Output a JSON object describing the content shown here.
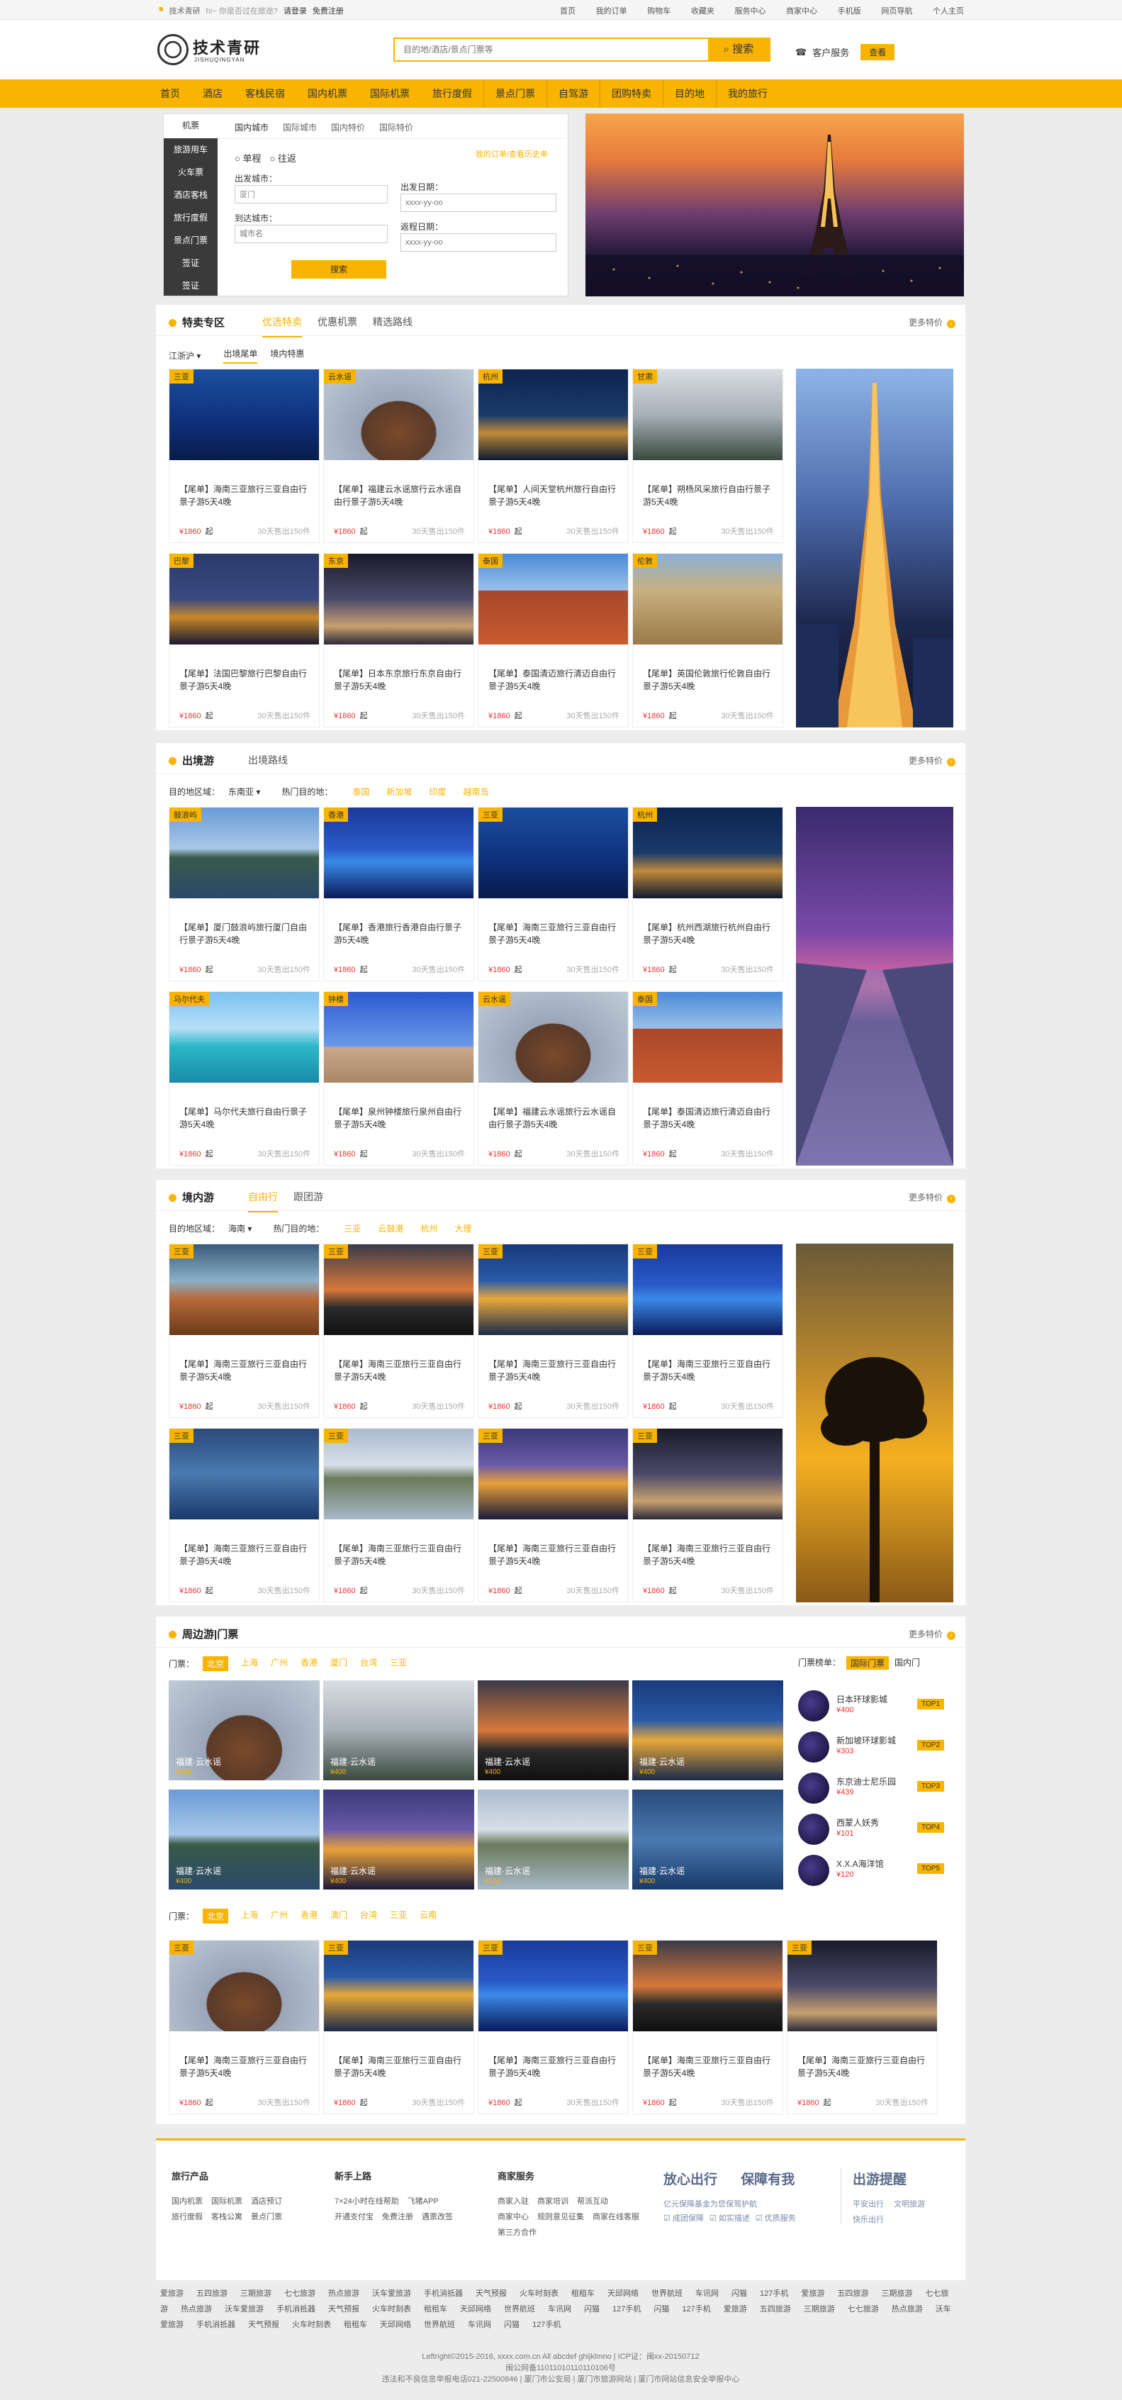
{
  "topbar": {
    "welcome": "技术青研",
    "greeting": "hi~ 你是否过在旅途?",
    "login": "请登录",
    "register": "免费注册",
    "links": [
      "首页",
      "我的订单",
      "购物车",
      "收藏夹",
      "服务中心",
      "商家中心",
      "手机版",
      "网页导航",
      "个人主页"
    ]
  },
  "header": {
    "logo_cn": "技术青研",
    "logo_en": "JISHUQINGYAN",
    "search_placeholder": "目的地/酒店/景点门票等",
    "search_button": "搜索",
    "service": "客户服务",
    "service_btn": "查看"
  },
  "nav": [
    "首页",
    "酒店",
    "客栈民宿",
    "国内机票",
    "国际机票",
    "旅行度假",
    "景点门票",
    "自驾游",
    "团购特卖",
    "目的地",
    "我的旅行"
  ],
  "booking": {
    "side": [
      "机票",
      "旅游用车",
      "火车票",
      "酒店客栈",
      "旅行度假",
      "景点门票",
      "签证",
      "签证"
    ],
    "tabs": [
      "国内城市",
      "国际城市",
      "国内特价",
      "国际特价"
    ],
    "trip_one": "单程",
    "trip_round": "往返",
    "my_orders": "我的订单/查看历史单",
    "from_label": "出发城市：",
    "from_value": "厦门",
    "to_label": "到达城市：",
    "to_placeholder": "城市名",
    "dep_label": "出发日期：",
    "dep_placeholder": "xxxx-yy-oo",
    "ret_label": "返程日期：",
    "ret_placeholder": "xxxx-yy-oo",
    "submit": "搜索"
  },
  "s1": {
    "title": "特卖专区",
    "tabs": [
      "优选特卖",
      "优惠机票",
      "精选路线"
    ],
    "more": "更多特价",
    "filter_city": "江浙沪",
    "filter_tabs": [
      "出境尾单",
      "境内特惠"
    ],
    "cards": [
      {
        "tag": "三亚",
        "title": "【尾单】海南三亚旅行三亚自由行景子游5天4晚",
        "img": "diver"
      },
      {
        "tag": "云水谣",
        "title": "【尾单】福建云水谣旅行云水谣自由行景子游5天4晚",
        "img": "tulou"
      },
      {
        "tag": "杭州",
        "title": "【尾单】人间天堂杭州旅行自由行景子游5天4晚",
        "img": "pagoda"
      },
      {
        "tag": "甘肃",
        "title": "【尾单】朔杨风采旅行自由行景子游5天4晚",
        "img": "mist"
      },
      {
        "tag": "巴黎",
        "title": "【尾单】法国巴黎旅行巴黎自由行景子游5天4晚",
        "img": "paris"
      },
      {
        "tag": "东京",
        "title": "【尾单】日本东京旅行东京自由行景子游5天4晚",
        "img": "tokyo"
      },
      {
        "tag": "泰国",
        "title": "【尾单】泰国清迈旅行清迈自由行景子游5天4晚",
        "img": "thai"
      },
      {
        "tag": "伦敦",
        "title": "【尾单】英国伦敦旅行伦敦自由行景子游5天4晚",
        "img": "london"
      }
    ]
  },
  "s2": {
    "title": "出境游",
    "tabs": [
      "出境路线"
    ],
    "more": "更多特价",
    "area_label": "目的地区域：",
    "area_value": "东南亚",
    "hot_label": "热门目的地：",
    "hot": [
      "泰国",
      "新加坡",
      "印度",
      "越南岛"
    ],
    "cards": [
      {
        "tag": "鼓浪屿",
        "title": "【尾单】厦门鼓浪屿旅行厦门自由行景子游5天4晚",
        "img": "gulang"
      },
      {
        "tag": "香港",
        "title": "【尾单】香港旅行香港自由行景子游5天4晚",
        "img": "hk"
      },
      {
        "tag": "三亚",
        "title": "【尾单】海南三亚旅行三亚自由行景子游5天4晚",
        "img": "diver"
      },
      {
        "tag": "杭州",
        "title": "【尾单】杭州西湖旅行杭州自由行景子游5天4晚",
        "img": "pagoda"
      },
      {
        "tag": "马尔代夫",
        "title": "【尾单】马尔代夫旅行自由行景子游5天4晚",
        "img": "maldives"
      },
      {
        "tag": "钟楼",
        "title": "【尾单】泉州钟楼旅行泉州自由行景子游5天4晚",
        "img": "clock"
      },
      {
        "tag": "云水谣",
        "title": "【尾单】福建云水谣旅行云水谣自由行景子游5天4晚",
        "img": "tulou"
      },
      {
        "tag": "泰国",
        "title": "【尾单】泰国清迈旅行清迈自由行景子游5天4晚",
        "img": "thai"
      }
    ]
  },
  "s3": {
    "title": "境内游",
    "tabs": [
      "自由行",
      "跟团游"
    ],
    "more": "更多特价",
    "area_label": "目的地区域：",
    "area_value": "海南",
    "hot_label": "热门目的地：",
    "hot": [
      "三亚",
      "云鼓港",
      "杭州",
      "大理"
    ],
    "cards": [
      {
        "tag": "三亚",
        "title": "【尾单】海南三亚旅行三亚自由行景子游5天4晚",
        "img": "resort"
      },
      {
        "tag": "三亚",
        "title": "【尾单】海南三亚旅行三亚自由行景子游5天4晚",
        "img": "sunset"
      },
      {
        "tag": "三亚",
        "title": "【尾单】海南三亚旅行三亚自由行景子游5天4晚",
        "img": "palace"
      },
      {
        "tag": "三亚",
        "title": "【尾单】海南三亚旅行三亚自由行景子游5天4晚",
        "img": "hk"
      },
      {
        "tag": "三亚",
        "title": "【尾单】海南三亚旅行三亚自由行景子游5天4晚",
        "img": "blue"
      },
      {
        "tag": "三亚",
        "title": "【尾单】海南三亚旅行三亚自由行景子游5天4晚",
        "img": "lake"
      },
      {
        "tag": "三亚",
        "title": "【尾单】海南三亚旅行三亚自由行景子游5天4晚",
        "img": "paris2"
      },
      {
        "tag": "三亚",
        "title": "【尾单】海南三亚旅行三亚自由行景子游5天4晚",
        "img": "tokyo"
      }
    ]
  },
  "card_price": "¥1860",
  "card_price_unit": "起",
  "card_sold": "30天售出150件",
  "s4": {
    "title": "周边游|门票",
    "more": "更多特价",
    "ticket_label": "门票：",
    "cities": [
      "北京",
      "上海",
      "广州",
      "香港",
      "厦门",
      "台湾",
      "三亚"
    ],
    "rank_label": "门票榜单：",
    "rank_tabs": [
      "国际门票",
      "国内门"
    ],
    "minis": [
      {
        "cap": "福建·云水谣",
        "img": "tulou"
      },
      {
        "cap": "福建·云水谣",
        "img": "mist"
      },
      {
        "cap": "福建·云水谣",
        "img": "sunset"
      },
      {
        "cap": "福建·云水谣",
        "img": "palace"
      },
      {
        "cap": "福建·云水谣",
        "img": "gulang"
      },
      {
        "cap": "福建·云水谣",
        "img": "paris2"
      },
      {
        "cap": "福建·云水谣",
        "img": "lake"
      },
      {
        "cap": "福建·云水谣",
        "img": "blue"
      }
    ],
    "mini_price": "¥400",
    "ranks": [
      {
        "name": "日本环球影城",
        "price": "¥400",
        "top": "TOP1"
      },
      {
        "name": "新加坡环球影城",
        "price": "¥303",
        "top": "TOP2"
      },
      {
        "name": "东京迪士尼乐园",
        "price": "¥439",
        "top": "TOP3"
      },
      {
        "name": "西蒙人妖秀",
        "price": "¥101",
        "top": "TOP4"
      },
      {
        "name": "X.X.A海洋馆",
        "price": "¥120",
        "top": "TOP5"
      }
    ],
    "cities2": [
      "北京",
      "上海",
      "广州",
      "香港",
      "澳门",
      "台湾",
      "三亚",
      "云南"
    ],
    "cards": [
      {
        "tag": "三亚",
        "title": "【尾单】海南三亚旅行三亚自由行景子游5天4晚",
        "img": "tulou"
      },
      {
        "tag": "三亚",
        "title": "【尾单】海南三亚旅行三亚自由行景子游5天4晚",
        "img": "palace"
      },
      {
        "tag": "三亚",
        "title": "【尾单】海南三亚旅行三亚自由行景子游5天4晚",
        "img": "hk"
      },
      {
        "tag": "三亚",
        "title": "【尾单】海南三亚旅行三亚自由行景子游5天4晚",
        "img": "sunset"
      },
      {
        "tag": "三亚",
        "title": "【尾单】海南三亚旅行三亚自由行景子游5天4晚",
        "img": "tokyo"
      }
    ]
  },
  "footer": {
    "cols": [
      {
        "h": "旅行产品",
        "items": [
          "国内机票",
          "国际机票",
          "酒店预订",
          "旅行度假",
          "客栈公寓",
          "景点门票"
        ]
      },
      {
        "h": "新手上路",
        "items": [
          "7×24小时在线帮助",
          "飞猪APP",
          "开通支付宝",
          "免费注册",
          "遇票改签"
        ]
      },
      {
        "h": "商家服务",
        "items": [
          "商家入驻",
          "商家培训",
          "帮派互动",
          "商家中心",
          "规则意见征集",
          "商家在线客服",
          "第三方合作"
        ]
      }
    ],
    "slogan1": "放心出行",
    "slogan2": "保障有我",
    "slogan_sub": "亿元保障基金为您保驾护航",
    "slogan_checks": [
      "成团保障",
      "如实描述",
      "优质服务"
    ],
    "tips_h": "出游提醒",
    "tips": [
      "平安出行",
      "文明旅游",
      "快乐出行"
    ],
    "links": [
      "爱旅游",
      "五四旅游",
      "三期旅游",
      "七七旅游",
      "热点旅游",
      "沃车爱旅游",
      "手机消抵器",
      "天气预报",
      "火车时刻表",
      "租租车",
      "天邱网络",
      "世界航班",
      "车讯网",
      "闪猫",
      "127手机",
      "爱旅游",
      "五四旅游",
      "三期旅游",
      "七七旅游",
      "热点旅游",
      "沃车爱旅游",
      "手机消抵器",
      "天气预报",
      "火车时刻表",
      "租租车",
      "天邱网络",
      "世界航班",
      "车讯网",
      "闪猫",
      "127手机",
      "闪猫",
      "127手机",
      "爱旅游",
      "五四旅游",
      "三期旅游",
      "七七旅游",
      "热点旅游",
      "沃车爱旅游",
      "手机消抵器",
      "天气预报",
      "火车时刻表",
      "租租车",
      "天邱网络",
      "世界航班",
      "车讯网",
      "闪猫",
      "127手机"
    ],
    "copy1": "Leftright©2015-2016, xxxx.com.cn All abcdef ghijklmno | ICP证：闽xx-20150712",
    "copy2": "闽公网备11011010110110106号",
    "copy3": "违法和不良信息举报电话021-22500846 | 厦门市公安局 | 厦门市旅游网站 | 厦门市网站信息安全举报中心"
  },
  "colors": {
    "accent": "#f8b400",
    "price": "#e33"
  }
}
